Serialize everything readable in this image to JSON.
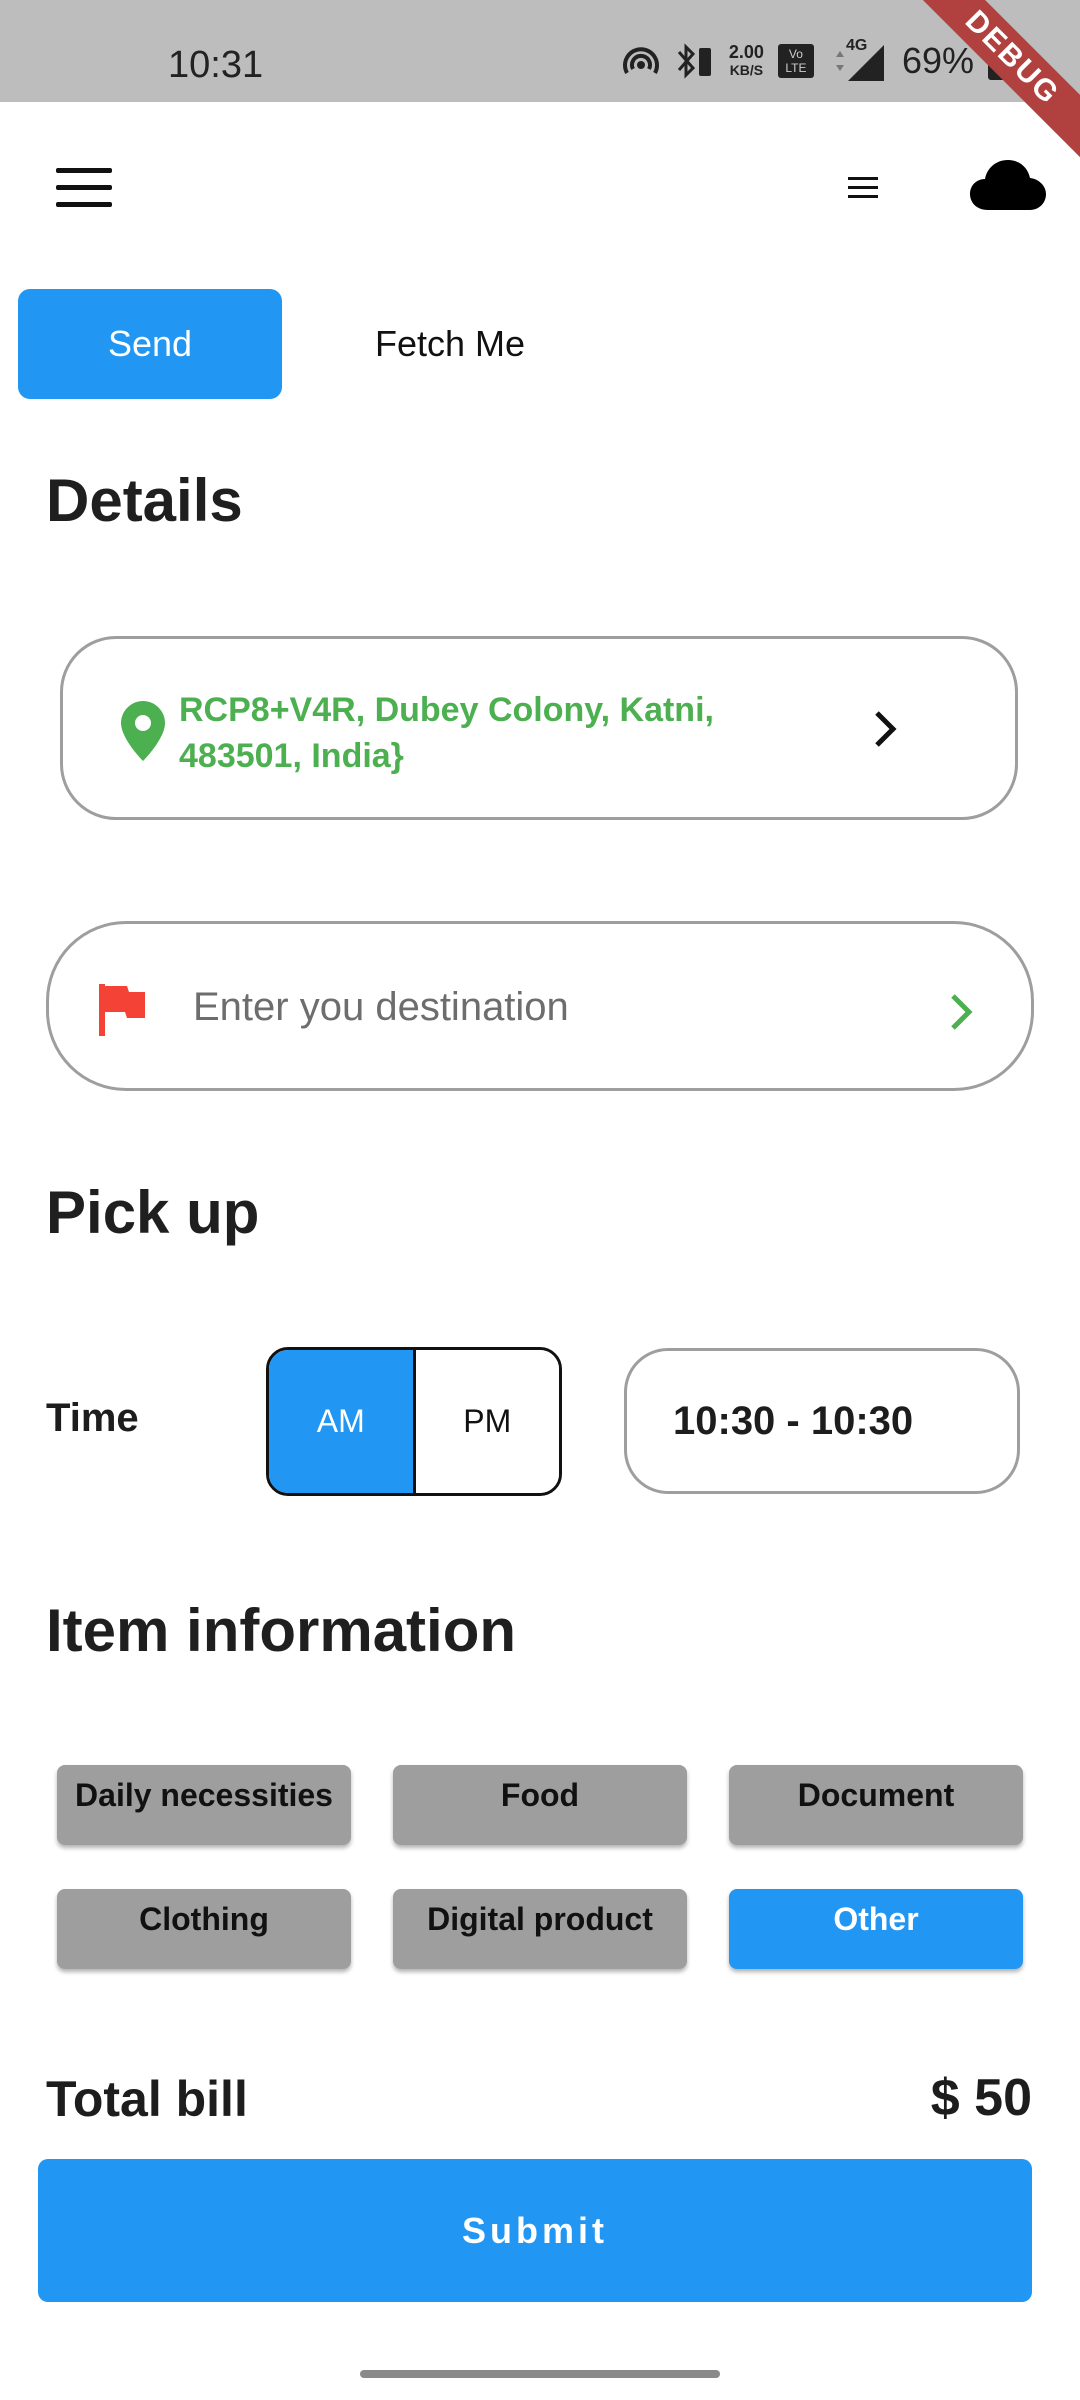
{
  "status_bar": {
    "time": "10:31",
    "net_speed_value": "2.00",
    "net_speed_unit": "KB/S",
    "network": "4G",
    "volte": "Vo LTE",
    "battery": "69%",
    "debug_banner": "DEBUG"
  },
  "tabs": [
    {
      "label": "Send",
      "active": true
    },
    {
      "label": "Fetch Me",
      "active": false
    }
  ],
  "details": {
    "title": "Details",
    "current_location": "RCP8+V4R, Dubey Colony, Katni, 483501, India}",
    "destination_placeholder": "Enter you destination"
  },
  "pickup": {
    "title": "Pick up",
    "time_label": "Time",
    "am_label": "AM",
    "pm_label": "PM",
    "selected_period": "AM",
    "time_range": "10:30 - 10:30"
  },
  "item_information": {
    "title": "Item information",
    "categories": [
      {
        "label": "Daily necessities",
        "selected": false
      },
      {
        "label": "Food",
        "selected": false
      },
      {
        "label": "Document",
        "selected": false
      },
      {
        "label": "Clothing",
        "selected": false
      },
      {
        "label": "Digital product",
        "selected": false
      },
      {
        "label": "Other",
        "selected": true
      }
    ]
  },
  "bill": {
    "label": "Total bill",
    "amount": "$ 50"
  },
  "submit_label": "Submit",
  "colors": {
    "primary": "#2196f3",
    "location_text": "#4caf50",
    "flag": "#f44336",
    "chip_gray": "#9e9e9e",
    "debug": "#b0413e"
  },
  "icons": [
    "hamburger-menu-icon",
    "menu-icon",
    "cloud-icon",
    "location-pin-icon",
    "chevron-right-icon",
    "flag-icon"
  ]
}
